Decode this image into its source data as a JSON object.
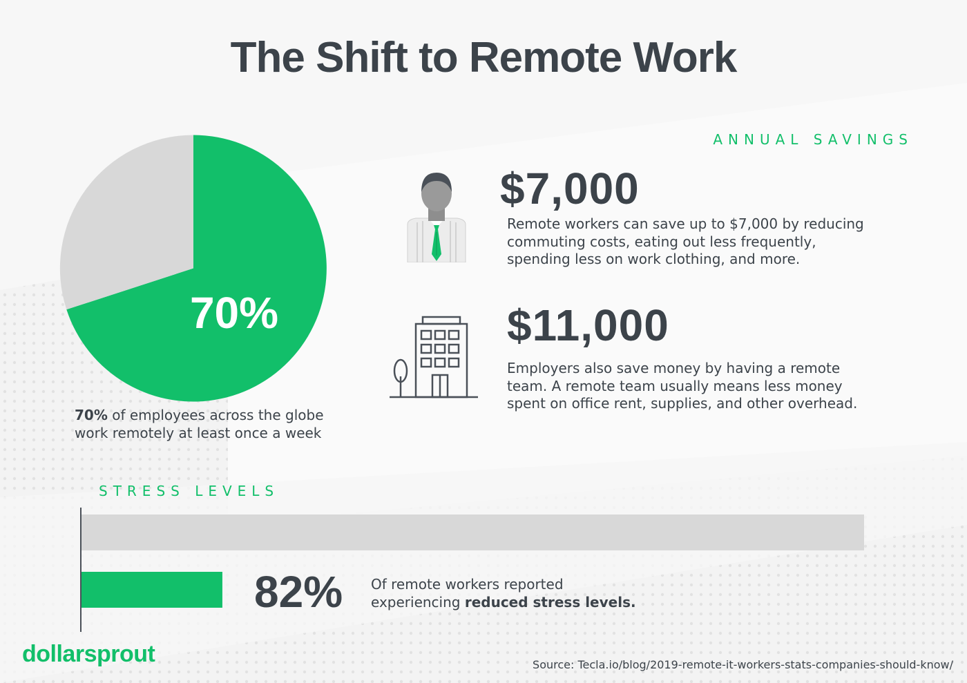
{
  "title": "The Shift to Remote Work",
  "colors": {
    "accent": "#12bf6a",
    "gray": "#d8d8d8",
    "text": "#3c434a"
  },
  "annual_savings": {
    "label": "ANNUAL SAVINGS",
    "items": [
      {
        "amount": "$7,000",
        "icon": "businessman-icon",
        "lines": [
          "Remote workers can save up to $7,000 by reducing",
          "commuting costs, eating out less frequently,",
          "spending less on work clothing, and more."
        ]
      },
      {
        "amount": "$11,000",
        "icon": "office-building-icon",
        "lines": [
          "Employers also save money by having a remote",
          "team. A remote team usually means less money",
          "spent on office rent, supplies, and other overhead."
        ]
      }
    ]
  },
  "pie": {
    "center_label": "70%",
    "caption_bold": "70%",
    "caption_rest": " of employees across the globe",
    "caption_line2": "work remotely at least once a week"
  },
  "stress": {
    "label": "STRESS LEVELS",
    "percent_label": "82%",
    "desc_line1": "Of remote workers reported",
    "desc_line2_plain": "experiencing ",
    "desc_line2_bold": "reduced stress levels."
  },
  "brand": {
    "logo_text": "dollarsprout"
  },
  "source": "Source: Tecla.io/blog/2019-remote-it-workers-stats-companies-should-know/",
  "chart_data": [
    {
      "type": "pie",
      "slices": [
        {
          "value": 70,
          "color": "#12bf6a"
        },
        {
          "value": 30,
          "color": "#d8d8d8"
        }
      ]
    },
    {
      "type": "bar",
      "orientation": "horizontal",
      "bars": [
        {
          "value": 100,
          "color": "#d8d8d8"
        },
        {
          "value": 18,
          "color": "#12bf6a"
        }
      ],
      "xlim": [
        0,
        100
      ]
    }
  ]
}
